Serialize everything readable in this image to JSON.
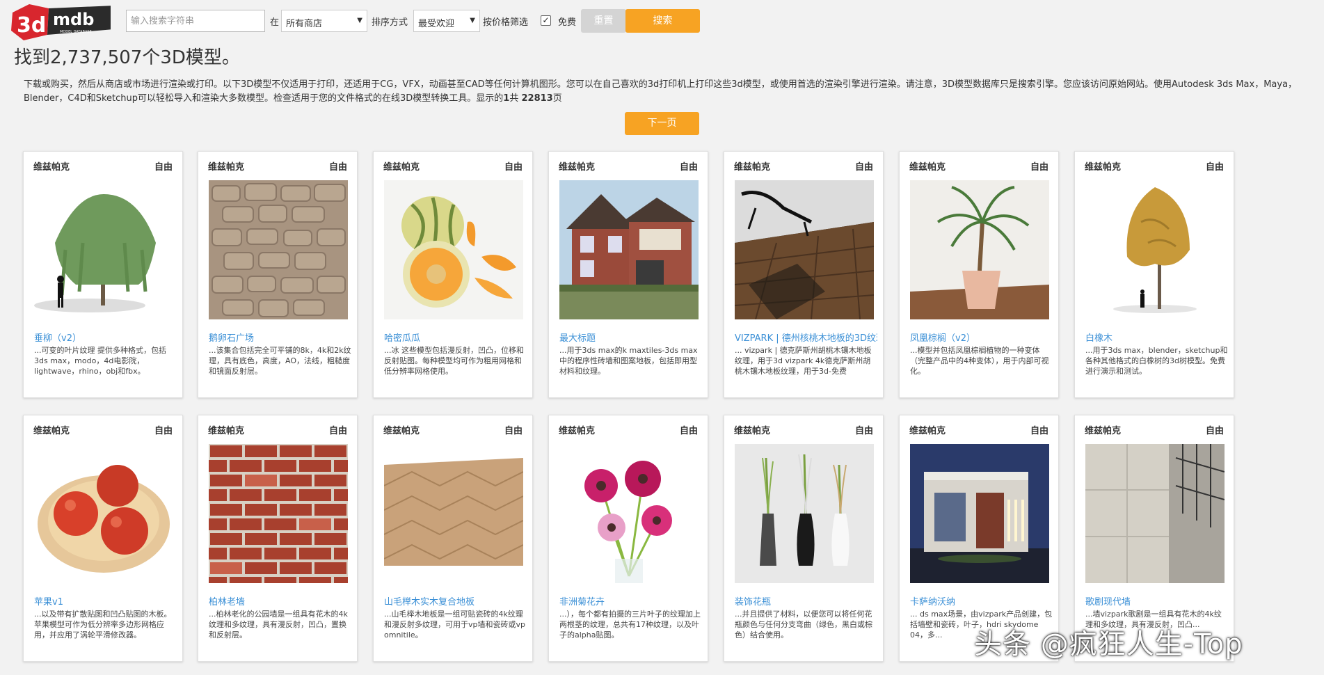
{
  "logo": {
    "brand": "3d mdb",
    "text_3d": "3d",
    "text_mdb": "mdb",
    "tagline": "MODEL DATABASE"
  },
  "search": {
    "placeholder": "输入搜索字符串",
    "in_label": "在",
    "store_value": "所有商店",
    "sort_label": "排序方式",
    "sort_value": "最受欢迎",
    "price_filter_label": "按价格筛选",
    "free_checked": true,
    "free_label": "免费",
    "reset_label": "重置",
    "search_label": "搜索"
  },
  "results": {
    "title": "找到2,737,507个3D模型。",
    "description": "下载或购买，然后从商店或市场进行渲染或打印。以下3D模型不仅适用于打印，还适用于CG，VFX，动画甚至CAD等任何计算机图形。您可以在自己喜欢的3d打印机上打印这些3d模型，或使用首选的渲染引擎进行渲染。请注意，3D模型数据库只是搜索引擎。您应该访问原始网站。使用Autodesk 3ds Max，Maya，Blender，C4D和Sketchup可以轻松导入和渲染大多数模型。检查适用于您的文件格式的在线3D模型转换工具。显示的",
    "page_current": "1",
    "page_of": "共",
    "page_total": "22813",
    "page_suffix": "页",
    "next_label": "下一页"
  },
  "models": [
    {
      "vendor": "维兹帕克",
      "license": "自由",
      "title": "垂柳（v2）",
      "desc": "...可变的叶片纹理 提供多种格式，包括3ds max，modo，4d电影院，lightwave，rhino，obj和fbx。",
      "thumb": "weeping-willow-tree-icon"
    },
    {
      "vendor": "维兹帕克",
      "license": "自由",
      "title": "鹅卵石广场",
      "desc": "...该集合包括完全可平铺的8k，4k和2k纹理，具有底色，高度，AO，法线，粗糙度和镜面反射层。",
      "thumb": "cobblestone-texture-icon"
    },
    {
      "vendor": "维兹帕克",
      "license": "自由",
      "title": "哈密瓜瓜",
      "desc": "...冰 这些模型包括漫反射，凹凸，位移和反射贴图。每种模型均可作为粗用网格和低分辨率网格使用。",
      "thumb": "melon-icon"
    },
    {
      "vendor": "维兹帕克",
      "license": "自由",
      "title": "最大标题",
      "desc": "...用于3ds max的k maxtiles-3ds max中的程序性砖墙和图案地板，包括即用型材料和纹理。",
      "thumb": "brick-house-icon"
    },
    {
      "vendor": "维兹帕克",
      "license": "自由",
      "title": "VIZPARK | 德州核桃木地板的3D纹理",
      "desc": "... vizpark | 德克萨斯州胡桃木镶木地板纹理，用于3d vizpark 4k德克萨斯州胡桃木镶木地板纹理，用于3d-免费",
      "thumb": "walnut-floor-room-icon"
    },
    {
      "vendor": "维兹帕克",
      "license": "自由",
      "title": "凤凰棕榈（v2）",
      "desc": "...模型并包括凤凰棕榈植物的一种变体（完整产品中的4种变体），用于内部可视化。",
      "thumb": "potted-palm-icon"
    },
    {
      "vendor": "维兹帕克",
      "license": "自由",
      "title": "白橡木",
      "desc": "...用于3ds max，blender，sketchup和各种其他格式的白橡树的3d树模型。免费进行演示和测试。",
      "thumb": "white-oak-tree-icon"
    },
    {
      "vendor": "维兹帕克",
      "license": "自由",
      "title": "苹果v1",
      "desc": "...以及带有扩散贴图和凹凸贴图的木板。苹果模型可作为低分辨率多边形网格应用，并应用了涡轮平滑修改器。",
      "thumb": "apples-bowl-icon"
    },
    {
      "vendor": "维兹帕克",
      "license": "自由",
      "title": "柏林老墙",
      "desc": "...柏林老化的公园墙是一组具有花木的4k纹理和多纹理，具有漫反射，凹凸，置换和反射层。",
      "thumb": "old-brick-wall-icon"
    },
    {
      "vendor": "维兹帕克",
      "license": "自由",
      "title": "山毛榉木实木复合地板",
      "desc": "...山毛榉木地板是一组可贴瓷砖的4k纹理和漫反射多纹理，可用于vp墙和瓷砖或vp omnitile。",
      "thumb": "herringbone-floor-icon"
    },
    {
      "vendor": "维兹帕克",
      "license": "自由",
      "title": "非洲菊花卉",
      "desc": "...），每个都有拍摄的三片叶子的纹理加上两根茎的纹理，总共有17种纹理，以及叶子的alpha贴图。",
      "thumb": "gerbera-flowers-icon"
    },
    {
      "vendor": "维兹帕克",
      "license": "自由",
      "title": "装饰花瓶",
      "desc": "...并且提供了材料，以便您可以将任何花瓶颜色与任何分支弯曲（绿色，黑白或棕色）结合使用。",
      "thumb": "vases-icon"
    },
    {
      "vendor": "维兹帕克",
      "license": "自由",
      "title": "卡萨纳沃纳",
      "desc": "... ds max场景，由vizpark产品创建，包括墙壁和瓷砖，叶子，hdri skydome 04，多...",
      "thumb": "modern-villa-icon"
    },
    {
      "vendor": "维兹帕克",
      "license": "自由",
      "title": "歌剧现代墙",
      "desc": "...墙vizpark歌剧是一组具有花木的4k纹理和多纹理，具有漫反射，凹凸...",
      "thumb": "concrete-wall-icon"
    }
  ],
  "watermark": "头条 @疯狂人生-Top"
}
